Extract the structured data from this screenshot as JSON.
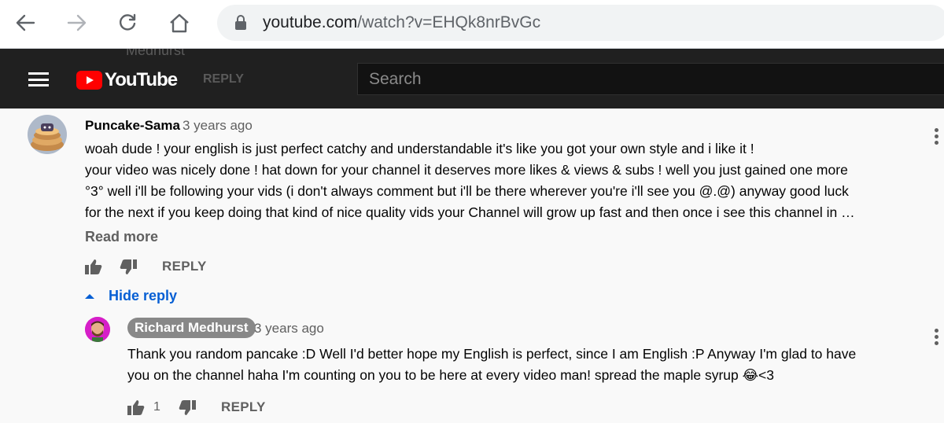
{
  "browser": {
    "url_host": "youtube.com",
    "url_path": "/watch?v=EHQk8nrBvGc",
    "icons": [
      "back-icon",
      "forward-icon",
      "reload-icon",
      "home-icon",
      "lock-icon"
    ]
  },
  "masthead": {
    "logo_text": "YouTube",
    "search_placeholder": "Search",
    "ghost_name": "Medhurst",
    "ghost_reply": "REPLY"
  },
  "comments": [
    {
      "author": "Puncake-Sama",
      "time": "3 years ago",
      "lines": [
        "woah dude ! your english is just perfect catchy and understandable it's like you got your own style and i like it !",
        "your video was nicely done ! hat down for your channel it deserves more likes & views & subs ! well you just gained one more",
        "°3° well i'll be following your vids (i don't always comment but i'll be there wherever you're i'll see you @.@) anyway good luck",
        "for the next if you keep doing that kind of nice quality vids your Channel will grow up fast and then once i see this channel in …"
      ],
      "read_more": "Read more",
      "reply_label": "REPLY"
    }
  ],
  "hide_reply_label": "Hide reply",
  "reply": {
    "author": "Richard Medhurst",
    "time": "3 years ago",
    "lines": [
      "Thank you random pancake :D Well I'd better hope my English is perfect, since I am English :P Anyway I'm glad to have",
      "you on the channel haha I'm counting on you to be here at every video man! spread the maple syrup 😂<3"
    ],
    "like_count": "1",
    "reply_label": "REPLY"
  },
  "colors": {
    "masthead_bg": "#202020",
    "youtube_red": "#ff0000",
    "link_blue": "#065fd4",
    "owner_badge_bg": "#888888"
  }
}
